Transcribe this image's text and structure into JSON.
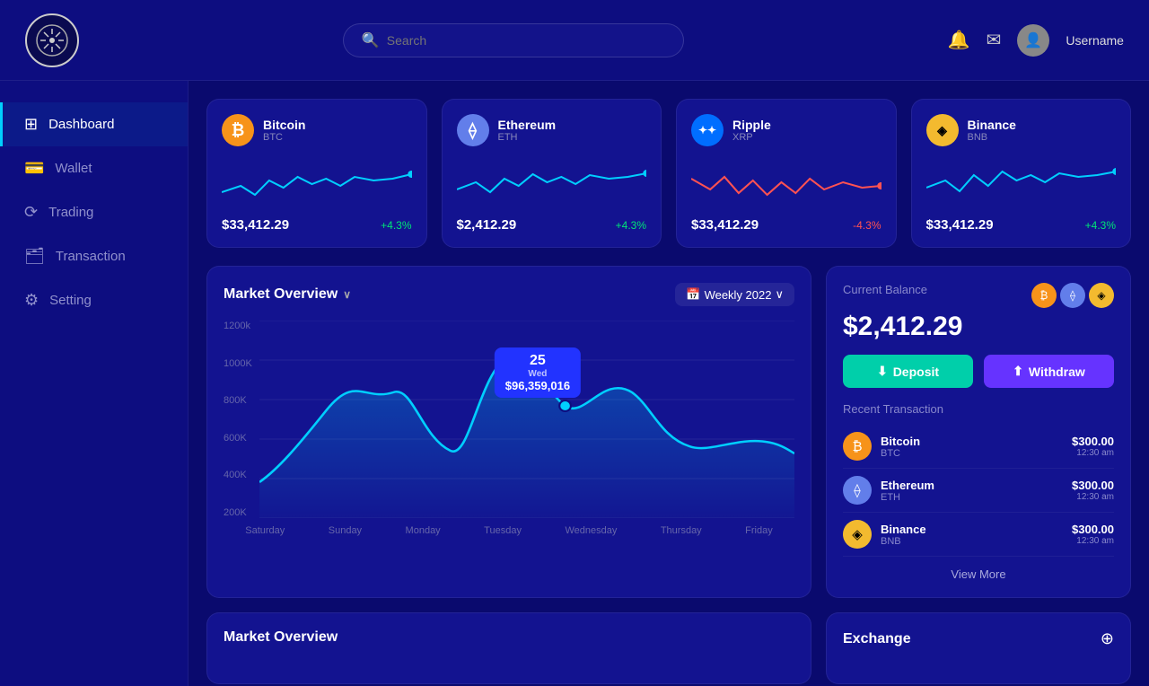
{
  "header": {
    "search_placeholder": "Search",
    "username": "Username"
  },
  "sidebar": {
    "items": [
      {
        "id": "dashboard",
        "label": "Dashboard",
        "icon": "⊞",
        "active": true
      },
      {
        "id": "wallet",
        "label": "Wallet",
        "icon": "💳",
        "active": false
      },
      {
        "id": "trading",
        "label": "Trading",
        "icon": "⟳",
        "active": false
      },
      {
        "id": "transaction",
        "label": "Transaction",
        "icon": "🗂",
        "active": false
      },
      {
        "id": "setting",
        "label": "Setting",
        "icon": "⚙",
        "active": false
      }
    ]
  },
  "crypto_cards": [
    {
      "id": "btc",
      "name": "Bitcoin",
      "symbol": "BTC",
      "price": "$33,412.29",
      "change": "+4.3%",
      "positive": true,
      "color": "#f7931a",
      "icon": "₿"
    },
    {
      "id": "eth",
      "name": "Ethereum",
      "symbol": "ETH",
      "price": "$2,412.29",
      "change": "+4.3%",
      "positive": true,
      "color": "#627eea",
      "icon": "⟠"
    },
    {
      "id": "xrp",
      "name": "Ripple",
      "symbol": "XRP",
      "price": "$33,412.29",
      "change": "-4.3%",
      "positive": false,
      "color": "#006eff",
      "icon": "✦"
    },
    {
      "id": "bnb",
      "name": "Binance",
      "symbol": "BNB",
      "price": "$33,412.29",
      "change": "+4.3%",
      "positive": true,
      "color": "#f3ba2f",
      "icon": "◈"
    }
  ],
  "market_overview": {
    "title": "Market Overview",
    "period": "Weekly 2022",
    "tooltip": {
      "day_num": "25",
      "day_name": "Wed",
      "value": "$96,359,016"
    },
    "y_labels": [
      "1200k",
      "1000K",
      "800K",
      "600K",
      "400K",
      "200K"
    ],
    "x_labels": [
      "Saturday",
      "Sunday",
      "Monday",
      "Tuesday",
      "Wednesday",
      "Thursday",
      "Friday"
    ]
  },
  "balance": {
    "label": "Current Balance",
    "amount": "$2,412.29",
    "deposit_label": "Deposit",
    "withdraw_label": "Withdraw",
    "recent_tx_label": "Recent Transaction",
    "transactions": [
      {
        "name": "Bitcoin",
        "symbol": "BTC",
        "amount": "$300.00",
        "time": "12:30 am",
        "color": "#f7931a",
        "icon": "₿"
      },
      {
        "name": "Ethereum",
        "symbol": "ETH",
        "amount": "$300.00",
        "time": "12:30 am",
        "color": "#627eea",
        "icon": "⟠"
      },
      {
        "name": "Binance",
        "symbol": "BNB",
        "amount": "$300.00",
        "time": "12:30 am",
        "color": "#f3ba2f",
        "icon": "◈"
      }
    ],
    "view_more": "View More"
  },
  "bottom": {
    "market_label": "Market Overview",
    "exchange_label": "Exchange"
  }
}
